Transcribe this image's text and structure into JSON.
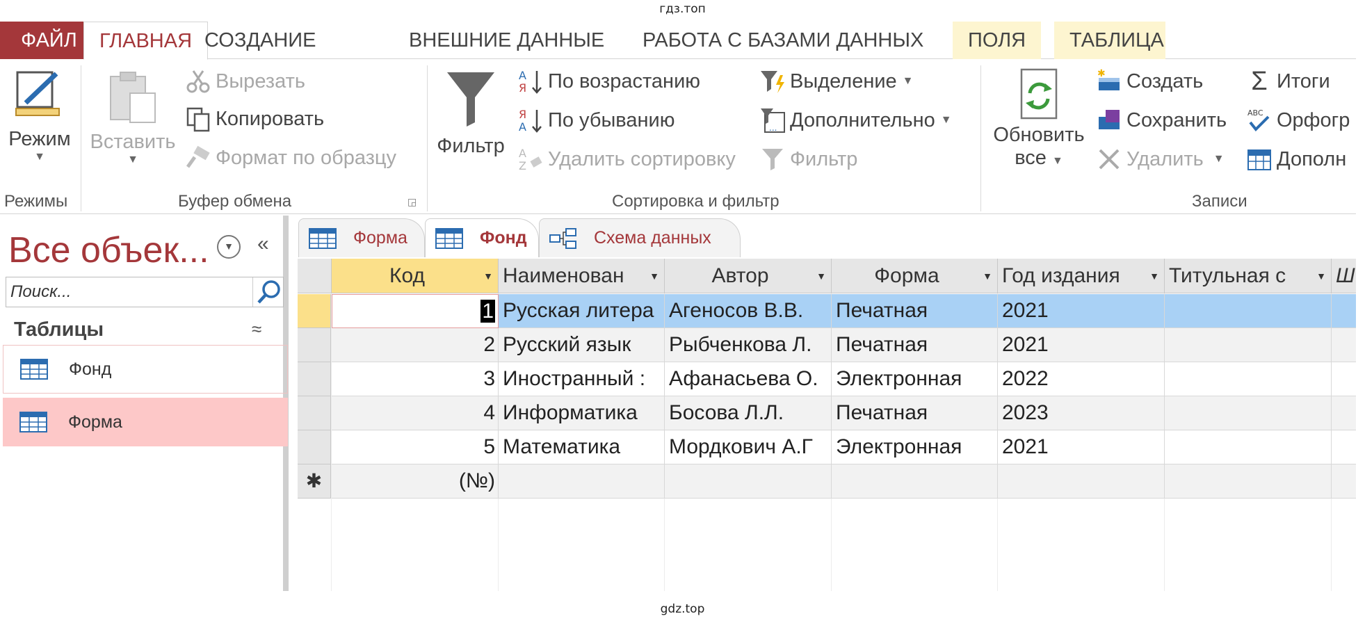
{
  "watermark": {
    "top": "гдз.топ",
    "bottom": "gdz.top"
  },
  "ribbon_tabs": [
    "ФАЙЛ",
    "ГЛАВНАЯ",
    "СОЗДАНИЕ",
    "ВНЕШНИЕ ДАННЫЕ",
    "РАБОТА С БАЗАМИ ДАННЫХ",
    "ПОЛЯ",
    "ТАБЛИЦА"
  ],
  "ribbon": {
    "modes": {
      "mode": "Режим",
      "label": "Режимы"
    },
    "clipboard": {
      "paste": "Вставить",
      "cut": "Вырезать",
      "copy": "Копировать",
      "format_painter": "Формат по образцу",
      "label": "Буфер обмена"
    },
    "sort_filter": {
      "filter": "Фильтр",
      "ascending": "По возрастанию",
      "descending": "По убыванию",
      "remove_sort": "Удалить сортировку",
      "selection": "Выделение",
      "advanced": "Дополнительно",
      "toggle_filter": "Фильтр",
      "label": "Сортировка и фильтр"
    },
    "records": {
      "refresh_1": "Обновить",
      "refresh_2": "все",
      "new": "Создать",
      "save": "Сохранить",
      "delete": "Удалить",
      "totals": "Итоги",
      "spelling": "Орфогр",
      "more": "Дополн",
      "label": "Записи"
    }
  },
  "nav": {
    "title": "Все объек...",
    "search_placeholder": "Поиск...",
    "section": "Таблицы",
    "items": [
      "Фонд",
      "Форма"
    ]
  },
  "doc_tabs": [
    "Форма",
    "Фонд",
    "Схема данных"
  ],
  "table": {
    "columns": [
      "Код",
      "Наименован",
      "Автор",
      "Форма",
      "Год издания",
      "Титульная с",
      "Ш"
    ],
    "rows": [
      {
        "id": "1",
        "name": "Русская литера",
        "author": "Агеносов В.В.",
        "form": "Печатная",
        "year": "2021"
      },
      {
        "id": "2",
        "name": "Русский язык",
        "author": "Рыбченкова Л.",
        "form": "Печатная",
        "year": "2021"
      },
      {
        "id": "3",
        "name": "Иностранный :",
        "author": "Афанасьева О.",
        "form": "Электронная",
        "year": "2022"
      },
      {
        "id": "4",
        "name": "Информатика",
        "author": "Босова Л.Л.",
        "form": "Печатная",
        "year": "2023"
      },
      {
        "id": "5",
        "name": "Математика",
        "author": "Мордкович А.Г",
        "form": "Электронная",
        "year": "2021"
      }
    ],
    "new_row_selector": "✱",
    "new_row_id": "(№)"
  },
  "colors": {
    "accent": "#a4373a",
    "selected_row": "#a9d1f5",
    "header_selected": "#fbe08a",
    "nav_selected": "#fdc8c8",
    "context_tabs": "#fdf5d0"
  }
}
